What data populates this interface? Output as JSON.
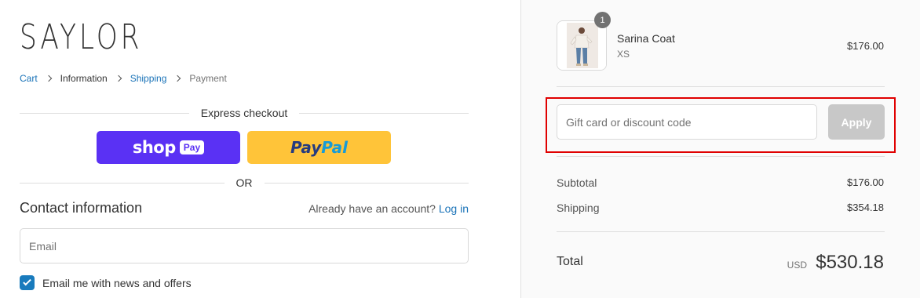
{
  "brand": {
    "logo_text": "SAYLOR"
  },
  "breadcrumb": {
    "items": [
      {
        "label": "Cart",
        "state": "link"
      },
      {
        "label": "Information",
        "state": "current"
      },
      {
        "label": "Shipping",
        "state": "link"
      },
      {
        "label": "Payment",
        "state": "plain"
      }
    ]
  },
  "express": {
    "heading": "Express checkout",
    "shop_pay": {
      "word": "shop",
      "badge": "Pay"
    },
    "paypal": {
      "part1": "Pay",
      "part2": "Pal"
    },
    "or_label": "OR"
  },
  "contact": {
    "title": "Contact information",
    "account_prompt": "Already have an account?",
    "login_label": "Log in",
    "email_placeholder": "Email",
    "email_value": "",
    "newsletter_label": "Email me with news and offers",
    "newsletter_checked": true
  },
  "summary": {
    "item": {
      "quantity": "1",
      "name": "Sarina Coat",
      "variant": "XS",
      "price": "$176.00"
    },
    "discount": {
      "placeholder": "Gift card or discount code",
      "value": "",
      "apply_label": "Apply"
    },
    "subtotal_label": "Subtotal",
    "subtotal_value": "$176.00",
    "shipping_label": "Shipping",
    "shipping_value": "$354.18",
    "total_label": "Total",
    "currency": "USD",
    "total_value": "$530.18"
  },
  "colors": {
    "link": "#1a73b8",
    "shop_pay": "#5a31f4",
    "paypal": "#ffc439",
    "highlight": "#e00000",
    "apply_disabled": "#c8c8c8"
  }
}
